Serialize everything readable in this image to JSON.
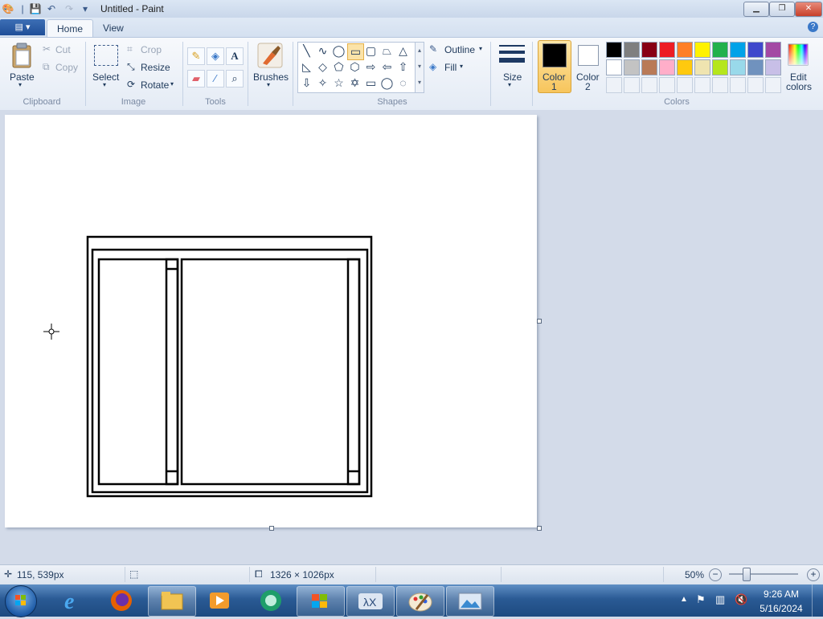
{
  "window": {
    "title": "Untitled - Paint"
  },
  "tabs": {
    "file": "▤ ▾",
    "home": "Home",
    "view": "View",
    "help": "?"
  },
  "clipboard": {
    "paste": "Paste",
    "cut": "Cut",
    "copy": "Copy",
    "label": "Clipboard"
  },
  "image": {
    "select": "Select",
    "crop": "Crop",
    "resize": "Resize",
    "rotate": "Rotate",
    "label": "Image"
  },
  "tools": {
    "label": "Tools",
    "text_tool": "A"
  },
  "brushes": {
    "label": "Brushes"
  },
  "shapes": {
    "outline": "Outline",
    "fill": "Fill",
    "label": "Shapes"
  },
  "size": {
    "label": "Size"
  },
  "color1": {
    "line1": "Color",
    "line2": "1",
    "value": "#000000"
  },
  "color2": {
    "line1": "Color",
    "line2": "2",
    "value": "#ffffff"
  },
  "colors": {
    "label": "Colors",
    "edit_line1": "Edit",
    "edit_line2": "colors",
    "palette_row1": [
      "#000000",
      "#7f7f7f",
      "#880015",
      "#ed1c24",
      "#ff7f27",
      "#fff200",
      "#22b14c",
      "#00a2e8",
      "#3f48cc",
      "#a349a4"
    ],
    "palette_row2": [
      "#ffffff",
      "#c3c3c3",
      "#b97a57",
      "#ffaec9",
      "#ffc90e",
      "#efe4b0",
      "#b5e61d",
      "#99d9ea",
      "#7092be",
      "#c8bfe7"
    ]
  },
  "status": {
    "cursor_pos": "115, 539px",
    "canvas_size": "1326 × 1026px",
    "zoom": "50%"
  },
  "taskbar": {
    "time": "9:26 AM",
    "date": "5/16/2024"
  }
}
